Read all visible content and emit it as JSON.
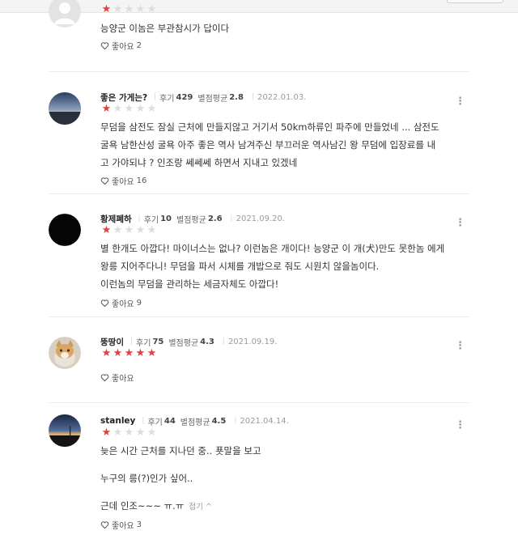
{
  "reviews": [
    {
      "nickname": "",
      "stars": 1,
      "lines": [
        "능양군 이놈은 부관참시가 답이다"
      ],
      "like_label": "좋아요",
      "like_count": "2"
    },
    {
      "nickname": "좋은 가게는?",
      "review_label": "후기",
      "review_count": "429",
      "avg_label": "별점평균",
      "avg": "2.8",
      "date": "2022.01.03.",
      "stars": 1,
      "lines": [
        "무덤을 삼전도 잠실 근처에 만들지않고 거기서 50km하류인 파주에 만들었네 ... 삼전도",
        "굴욕 남한산성 굴욕 아주 좋은 역사 남겨주신 부끄러운 역사남긴 왕 무덤에 입장료를 내",
        "고 가야되냐 ? 인조랑 쎄쎄쎄 하면서 지내고 있겠네"
      ],
      "like_label": "좋아요",
      "like_count": "16"
    },
    {
      "nickname": "황제폐하",
      "review_label": "후기",
      "review_count": "10",
      "avg_label": "별점평균",
      "avg": "2.6",
      "date": "2021.09.20.",
      "stars": 1,
      "lines": [
        "별 한개도 아깝다! 마이너스는 없나? 이런놈은 개이다! 능양군 이 개(犬)만도 못한놈 에게",
        "왕릉 지어주다니! 무덤을 파서 시체를 개밥으로 줘도 시원치 않을놈이다.",
        "이런놈의 무덤을 관리하는 세금자체도 아깝다!"
      ],
      "like_label": "좋아요",
      "like_count": "9"
    },
    {
      "nickname": "뚱땅이",
      "review_label": "후기",
      "review_count": "75",
      "avg_label": "별점평균",
      "avg": "4.3",
      "date": "2021.09.19.",
      "stars": 5,
      "lines": [],
      "like_label": "좋아요",
      "like_count": ""
    },
    {
      "nickname": "stanley",
      "review_label": "후기",
      "review_count": "44",
      "avg_label": "별점평균",
      "avg": "4.5",
      "date": "2021.04.14.",
      "stars": 1,
      "lines": [
        "늦은 시간 근처를 지나던 중.. 푯말을 보고",
        "",
        "누구의 릉(?)인가 싶어..",
        "",
        "근데 인조~~~ ㅠ.ㅠ"
      ],
      "fold_label": "접기 ^",
      "like_label": "좋아요",
      "like_count": "3"
    }
  ],
  "colors": {
    "star_on": "#ee3c3c",
    "star_off": "#dcdcdc"
  },
  "icons": {
    "like": "heart-outline-icon",
    "more": "vertical-ellipsis-icon"
  }
}
